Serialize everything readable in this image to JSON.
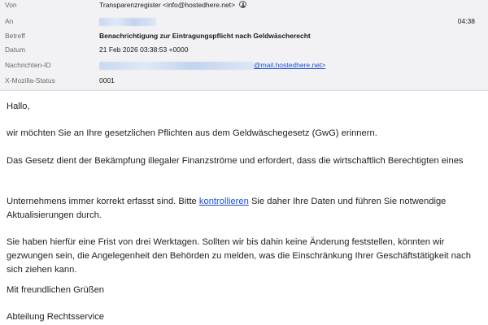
{
  "header": {
    "from": {
      "label": "Von",
      "value": "Transparenzregister <info@hostedhere.net>",
      "icon": "contact-icon"
    },
    "to": {
      "label": "An",
      "value": "",
      "time": "04:38"
    },
    "subject": {
      "label": "Betreff",
      "value": "Benachrichtigung zur Eintragungspflicht nach Geldwäscherecht"
    },
    "date": {
      "label": "Datum",
      "value": "21 Feb 2026 03:38:53 +0000"
    },
    "message_id": {
      "label": "Nachrichten-ID",
      "link_suffix": "@mail.hostedhere.net>"
    },
    "mozilla_status": {
      "label": "X-Mozilla-Status",
      "value": "0001"
    }
  },
  "body": {
    "greeting": "Hallo,",
    "p1": "wir möchten Sie an Ihre gesetzlichen Pflichten aus dem Geldwäschegesetz (GwG) erinnern.",
    "p2": "Das Gesetz dient der Bekämpfung illegaler Finanzströme und erfordert, dass die wirtschaftlich Berechtigten eines",
    "p3_before": "Unternehmens immer korrekt erfasst sind. Bitte ",
    "p3_link": "kontrollieren",
    "p3_after": " Sie daher Ihre Daten und führen Sie notwendige Aktualisierungen durch.",
    "p4": "Sie haben hierfür eine Frist von drei Werktagen. Sollten wir bis dahin keine Änderung feststellen, könnten wir gezwungen sein, die Angelegenheit den Behörden zu melden, was die Einschränkung Ihrer Geschäftstätigkeit nach sich ziehen kann.",
    "closing": "Mit freundlichen Grüßen",
    "signature": "Abteilung Rechtsservice"
  },
  "colors": {
    "header_bg": "#f2f2f4",
    "link": "#1a4fd6",
    "label": "#6a6a6a"
  }
}
